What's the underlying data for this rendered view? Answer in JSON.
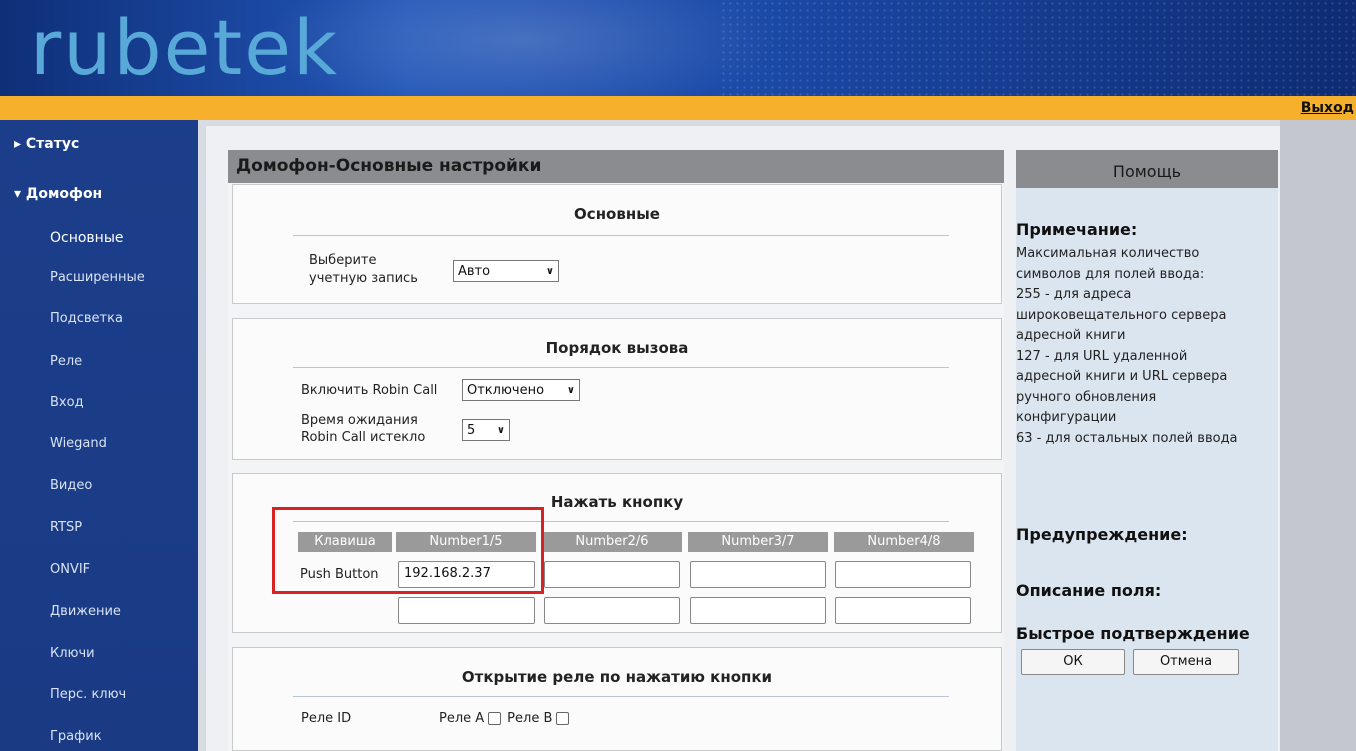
{
  "header": {
    "logo_text": "rubetek",
    "logout_label": "Выход"
  },
  "sidebar": {
    "groups": [
      {
        "label": "▸ Статус"
      },
      {
        "label": "▾ Домофон"
      }
    ],
    "items": [
      {
        "label": "Основные"
      },
      {
        "label": "Расширенные"
      },
      {
        "label": "Подсветка"
      },
      {
        "label": "Реле"
      },
      {
        "label": "Вход"
      },
      {
        "label": "Wiegand"
      },
      {
        "label": "Видео"
      },
      {
        "label": "RTSP"
      },
      {
        "label": "ONVIF"
      },
      {
        "label": "Движение"
      },
      {
        "label": "Ключи"
      },
      {
        "label": "Перс. ключ"
      },
      {
        "label": "График"
      }
    ]
  },
  "content": {
    "title": "Домофон-Основные настройки",
    "basic": {
      "title": "Основные",
      "account_label_1": "Выберите",
      "account_label_2": "учетную запись",
      "account_value": "Авто"
    },
    "call_order": {
      "title": "Порядок вызова",
      "robin_label": "Включить Robin Call",
      "robin_value": "Отключено",
      "timeout_label_1": "Время ожидания",
      "timeout_label_2": "Robin Call истекло",
      "timeout_value": "5"
    },
    "push_button": {
      "title": "Нажать кнопку",
      "headers": [
        "Клавиша",
        "Number1/5",
        "Number2/6",
        "Number3/7",
        "Number4/8"
      ],
      "row_label": "Push Button",
      "row1_values": [
        "192.168.2.37",
        "",
        "",
        ""
      ],
      "row2_values": [
        "",
        "",
        "",
        ""
      ]
    },
    "relay_open": {
      "title": "Открытие реле по нажатию кнопки",
      "relay_id_label": "Реле ID",
      "relay_a_label": "Реле A",
      "relay_b_label": "Реле B"
    }
  },
  "help": {
    "title": "Помощь",
    "note_heading": "Примечание:",
    "note_lines": [
      "Максимальная количество",
      "символов для полей ввода:",
      "255 - для адреса",
      "широковещательного сервера",
      "адресной книги",
      "127 - для URL удаленной",
      "адресной книги и URL сервера",
      "ручного обновления",
      "конфигурации",
      "63 - для остальных полей ввода"
    ],
    "warning_heading": "Предупреждение:",
    "field_desc_heading": "Описание поля:",
    "quick_confirm_heading": "Быстрое подтверждение",
    "ok_label": "ОК",
    "cancel_label": "Отмена"
  },
  "colors": {
    "accent_orange": "#f7b02b",
    "sidebar_blue": "#1c3e8a",
    "highlight_red": "#d62222"
  }
}
